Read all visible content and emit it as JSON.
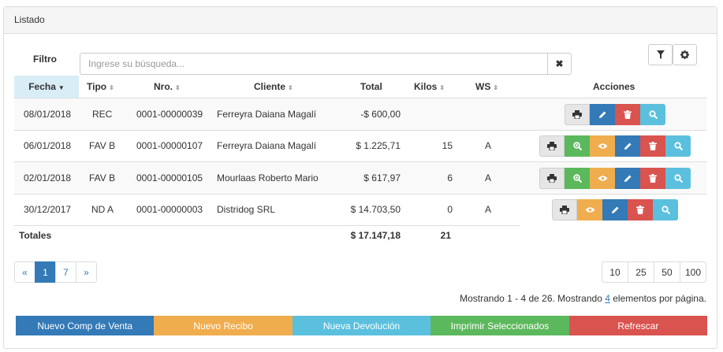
{
  "panel": {
    "title": "Listado"
  },
  "filter": {
    "label": "Filtro",
    "placeholder": "Ingrese su búsqueda...",
    "clear_symbol": "✖"
  },
  "toolbar": {
    "filter_icon": "filter-icon",
    "settings_icon": "gear-icon"
  },
  "table": {
    "headers": {
      "fecha": "Fecha",
      "tipo": "Tipo",
      "nro": "Nro.",
      "cliente": "Cliente",
      "total": "Total",
      "kilos": "Kilos",
      "ws": "WS",
      "acciones": "Acciones"
    },
    "sort_symbol": "⬍",
    "sort_active_symbol": "▼",
    "rows": [
      {
        "fecha": "08/01/2018",
        "tipo": "REC",
        "nro": "0001-00000039",
        "cliente": "Ferreyra Daiana Magalí",
        "total": "-$ 600,00",
        "kilos": "",
        "ws": ""
      },
      {
        "fecha": "06/01/2018",
        "tipo": "FAV B",
        "nro": "0001-00000107",
        "cliente": "Ferreyra Daiana Magalí",
        "total": "$ 1.225,71",
        "kilos": "15",
        "ws": "A"
      },
      {
        "fecha": "02/01/2018",
        "tipo": "FAV B",
        "nro": "0001-00000105",
        "cliente": "Mourlaas Roberto Mario",
        "total": "$ 617,97",
        "kilos": "6",
        "ws": "A"
      },
      {
        "fecha": "30/12/2017",
        "tipo": "ND A",
        "nro": "0001-00000003",
        "cliente": "Distridog SRL",
        "total": "$ 14.703,50",
        "kilos": "0",
        "ws": "A"
      }
    ],
    "totals": {
      "label": "Totales",
      "total": "$ 17.147,18",
      "kilos": "21"
    }
  },
  "pagination": {
    "prev": "«",
    "pages": [
      "1",
      "7"
    ],
    "active_page": "1",
    "next": "»"
  },
  "page_sizes": [
    "10",
    "25",
    "50",
    "100"
  ],
  "status": {
    "prefix": "Mostrando 1 - 4 de 26. Mostrando ",
    "count": "4",
    "suffix": " elementos por página."
  },
  "actions": {
    "nuevo_venta": "Nuevo Comp de Venta",
    "nuevo_recibo": "Nuevo Recibo",
    "nueva_devolucion": "Nueva Devolución",
    "imprimir": "Imprimir Seleccionados",
    "refrescar": "Refrescar"
  },
  "colors": {
    "primary": "#337ab7",
    "warning": "#f0ad4e",
    "info": "#5bc0de",
    "success": "#5cb85c",
    "danger": "#d9534f"
  }
}
